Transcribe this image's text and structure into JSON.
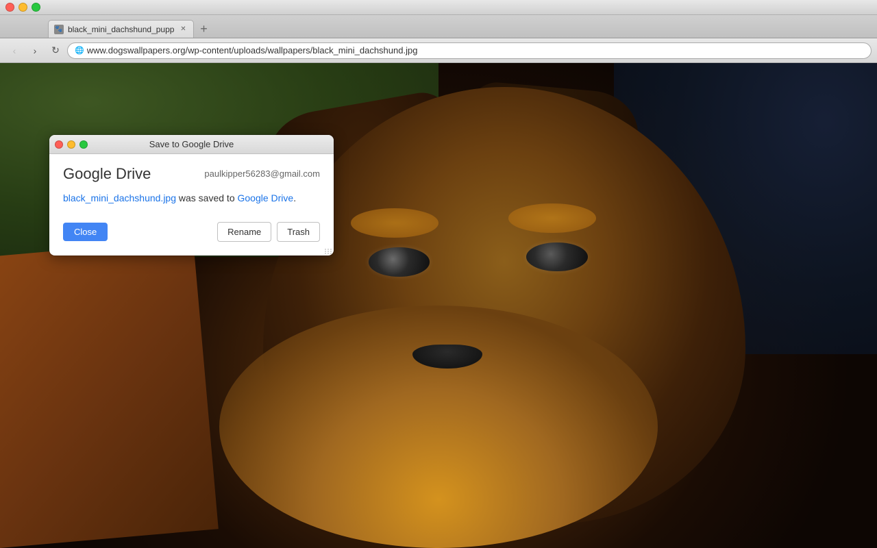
{
  "browser": {
    "tab": {
      "title": "black_mini_dachshund_pupp",
      "favicon_label": "🐾"
    },
    "address": "www.dogswallpapers.org/wp-content/uploads/wallpapers/black_mini_dachshund.jpg",
    "nav": {
      "back_label": "‹",
      "forward_label": "›",
      "reload_label": "↻"
    }
  },
  "dialog": {
    "title": "Save to Google Drive",
    "titlebar_buttons": {
      "close": "●",
      "minimize": "●",
      "maximize": "●"
    },
    "app_name": "Google Drive",
    "email": "paulkipper56283@gmail.com",
    "message_prefix": "",
    "file_link_text": "black_mini_dachshund.jpg",
    "message_middle": " was saved to ",
    "drive_link_text": "Google Drive",
    "message_suffix": ".",
    "buttons": {
      "close_label": "Close",
      "rename_label": "Rename",
      "trash_label": "Trash"
    }
  }
}
